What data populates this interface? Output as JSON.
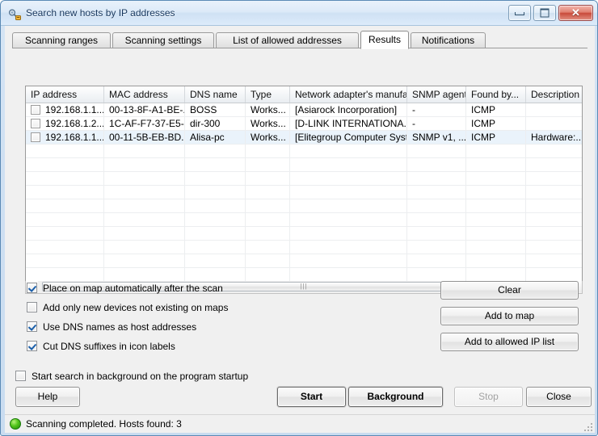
{
  "window": {
    "title": "Search new hosts by IP addresses",
    "icon": "network-search-icon",
    "minimize_label": "Minimize",
    "maximize_label": "Maximize",
    "close_label": "Close",
    "close_glyph": "✕"
  },
  "tabs": [
    {
      "label": "Scanning ranges",
      "active": false
    },
    {
      "label": "Scanning settings",
      "active": false
    },
    {
      "label": "List of allowed addresses",
      "active": false
    },
    {
      "label": "Results",
      "active": true
    },
    {
      "label": "Notifications",
      "active": false
    }
  ],
  "table": {
    "columns": [
      "IP address",
      "MAC address",
      "DNS name",
      "Type",
      "Network adapter's manufa...",
      "SNMP agent",
      "Found by...",
      "Description"
    ],
    "rows": [
      {
        "checked": false,
        "selected": false,
        "cells": [
          "192.168.1.1...",
          "00-13-8F-A1-BE-...",
          "BOSS",
          "Works...",
          "[Asiarock Incorporation]",
          "-",
          "ICMP",
          ""
        ]
      },
      {
        "checked": false,
        "selected": false,
        "cells": [
          "192.168.1.2...",
          "1C-AF-F7-37-E5-...",
          "dir-300",
          "Works...",
          "[D-LINK INTERNATIONA...",
          "-",
          "ICMP",
          ""
        ]
      },
      {
        "checked": false,
        "selected": true,
        "cells": [
          "192.168.1.1...",
          "00-11-5B-EB-BD...",
          "Alisa-pc",
          "Works...",
          "[Elitegroup Computer Syst...",
          "SNMP v1, ...",
          "ICMP",
          "Hardware:..."
        ]
      }
    ],
    "empty_row_count": 10
  },
  "scrollbar": {
    "left_arrow": "scroll-left",
    "right_arrow": "scroll-right",
    "grip": "|||"
  },
  "options": [
    {
      "label": "Place on map automatically after the scan",
      "checked": true
    },
    {
      "label": "Add only new devices not existing on maps",
      "checked": false
    },
    {
      "label": "Use DNS names as host addresses",
      "checked": true
    },
    {
      "label": "Cut DNS suffixes in icon labels",
      "checked": true
    }
  ],
  "side_buttons": [
    {
      "label": "Clear"
    },
    {
      "label": "Add to map"
    },
    {
      "label": "Add to allowed IP list"
    }
  ],
  "startup_option": {
    "label": "Start search in background on the program startup",
    "checked": false
  },
  "footer_buttons": {
    "help": {
      "label": "Help",
      "bold": false,
      "disabled": false
    },
    "start": {
      "label": "Start",
      "bold": true,
      "disabled": false
    },
    "background": {
      "label": "Background",
      "bold": true,
      "disabled": false
    },
    "stop": {
      "label": "Stop",
      "bold": false,
      "disabled": true
    },
    "close": {
      "label": "Close",
      "bold": false,
      "disabled": false
    }
  },
  "status": {
    "text": "Scanning completed. Hosts found: 3",
    "led_color": "#52c41a"
  }
}
